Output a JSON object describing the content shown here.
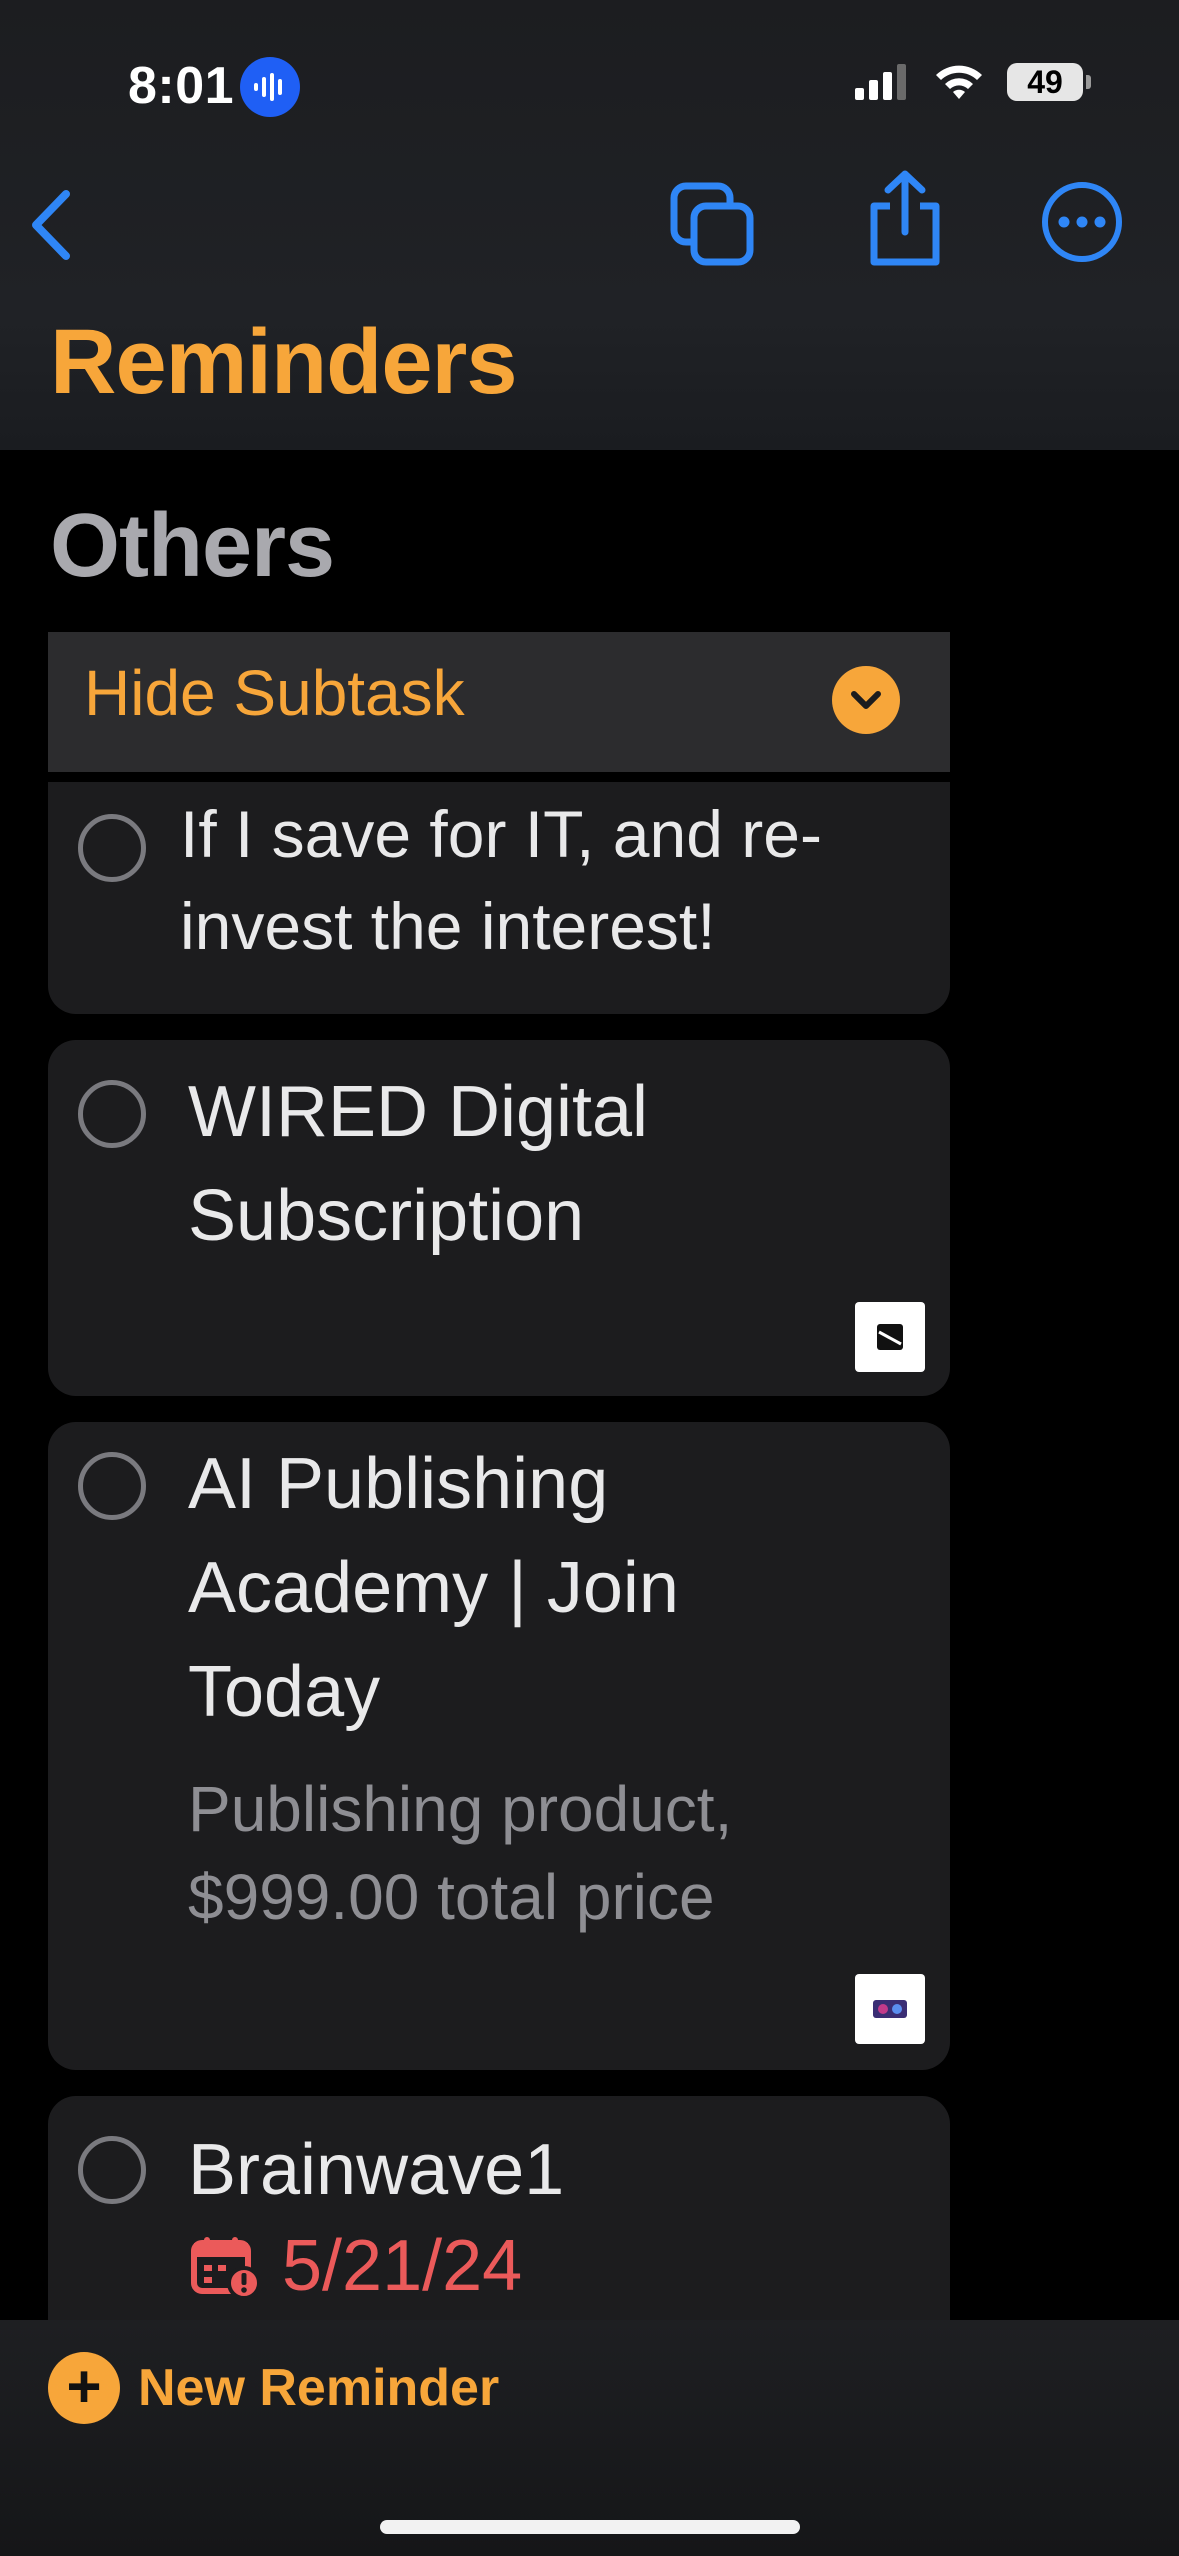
{
  "status_bar": {
    "time": "8:01",
    "battery": "49"
  },
  "header": {
    "title": "Reminders"
  },
  "section": {
    "title": "Others"
  },
  "subtask_toggle": {
    "label": "Hide Subtask"
  },
  "reminders": [
    {
      "title_line1": "If I save for IT, and re-",
      "title_line2": "invest the interest!"
    },
    {
      "title_line1": "WIRED Digital",
      "title_line2": "Subscription"
    },
    {
      "title_line1": "AI Publishing",
      "title_line2": "Academy | Join",
      "title_line3": "Today",
      "note_line1": "Publishing product,",
      "note_line2": "$999.00 total price"
    },
    {
      "title_line1": "Brainwave1",
      "date": "5/21/24"
    }
  ],
  "toolbar": {
    "new_reminder_label": "New Reminder"
  },
  "colors": {
    "accent": "#f7a63a",
    "link": "#2f86f6",
    "overdue": "#eb5a5a"
  },
  "icons": [
    "back-chevron-icon",
    "copy-icon",
    "share-icon",
    "more-icon",
    "calendar-alert-icon",
    "plus-icon"
  ]
}
